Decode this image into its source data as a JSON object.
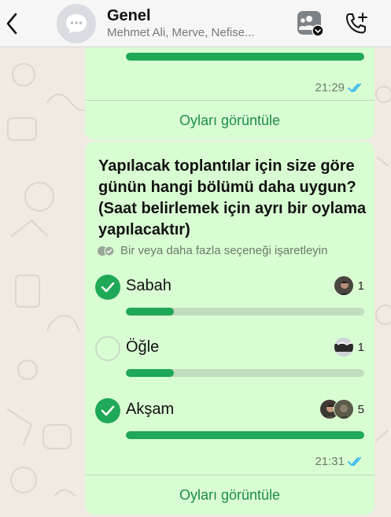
{
  "header": {
    "title": "Genel",
    "subtitle": "Mehmet Ali, Merve, Nefise...",
    "back_icon": "chevron-left-icon",
    "community_icon": "community-icon",
    "call_icon": "add-call-icon"
  },
  "message1": {
    "poll_fill": 1.0,
    "time": "21:29",
    "view_votes": "Oyları görüntüle"
  },
  "message2": {
    "question": "Yapılacak toplantılar için size göre günün hangi bölümü daha uygun? (Saat belirlemek için ayrı bir oylama yapılacaktır)",
    "hint": "Bir veya daha fazla seçeneği işaretleyin",
    "options": [
      {
        "label": "Sabah",
        "checked": true,
        "votes": "1",
        "fill": 0.2
      },
      {
        "label": "Öğle",
        "checked": false,
        "votes": "1",
        "fill": 0.2
      },
      {
        "label": "Akşam",
        "checked": true,
        "votes": "5",
        "fill": 1.0
      }
    ],
    "time": "21:31",
    "view_votes": "Oyları görüntüle"
  },
  "colors": {
    "bubble": "#d9fdd3",
    "accent": "#1fa855",
    "read_ticks": "#34b7f1"
  }
}
